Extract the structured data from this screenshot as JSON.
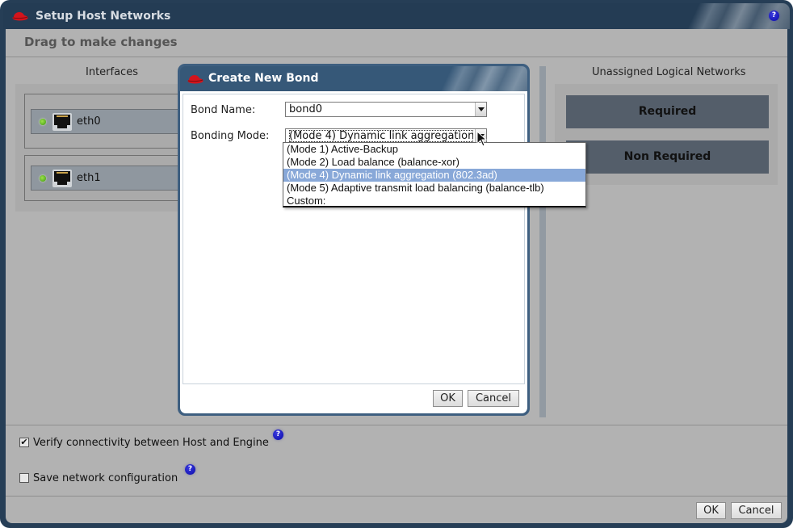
{
  "window": {
    "title": "Setup Host Networks",
    "hint": "Drag to make changes",
    "help_icon": "question-mark-icon",
    "logo_icon": "redhat-hat-icon"
  },
  "interfaces": {
    "title": "Interfaces",
    "items": [
      {
        "name": "eth0",
        "status": "up",
        "status_color": "#5cb82a",
        "icon": "ethernet-port-icon"
      },
      {
        "name": "eth1",
        "status": "up",
        "status_color": "#5cb82a",
        "icon": "ethernet-port-icon"
      }
    ]
  },
  "unassigned_networks": {
    "title": "Unassigned Logical Networks",
    "groups": [
      {
        "label": "Required"
      },
      {
        "label": "Non Required"
      }
    ]
  },
  "options": {
    "verify_connectivity": {
      "label": "Verify connectivity between Host and Engine",
      "checked": true
    },
    "save_network": {
      "label": "Save network configuration",
      "checked": false
    }
  },
  "footer": {
    "ok_label": "OK",
    "cancel_label": "Cancel"
  },
  "bond_dialog": {
    "title": "Create New Bond",
    "bond_name_label": "Bond Name:",
    "bond_name_value": "bond0",
    "bonding_mode_label": "Bonding Mode:",
    "bonding_mode_value": "(Mode 4) Dynamic link aggregation (802.3ad)",
    "bonding_mode_options": [
      {
        "label": "(Mode 1) Active-Backup",
        "selected": false
      },
      {
        "label": "(Mode 2) Load balance (balance-xor)",
        "selected": false
      },
      {
        "label": "(Mode 4) Dynamic link aggregation (802.3ad)",
        "selected": true
      },
      {
        "label": "(Mode 5) Adaptive transmit load balancing (balance-tlb)",
        "selected": false
      },
      {
        "label": "Custom:",
        "selected": false
      }
    ],
    "ok_label": "OK",
    "cancel_label": "Cancel"
  },
  "colors": {
    "titlebar": "#243c54",
    "dialog_titlebar": "#365878",
    "panel_bg": "#b2b2b2",
    "network_box": "#545e6a",
    "selection": "#88a8d8"
  }
}
